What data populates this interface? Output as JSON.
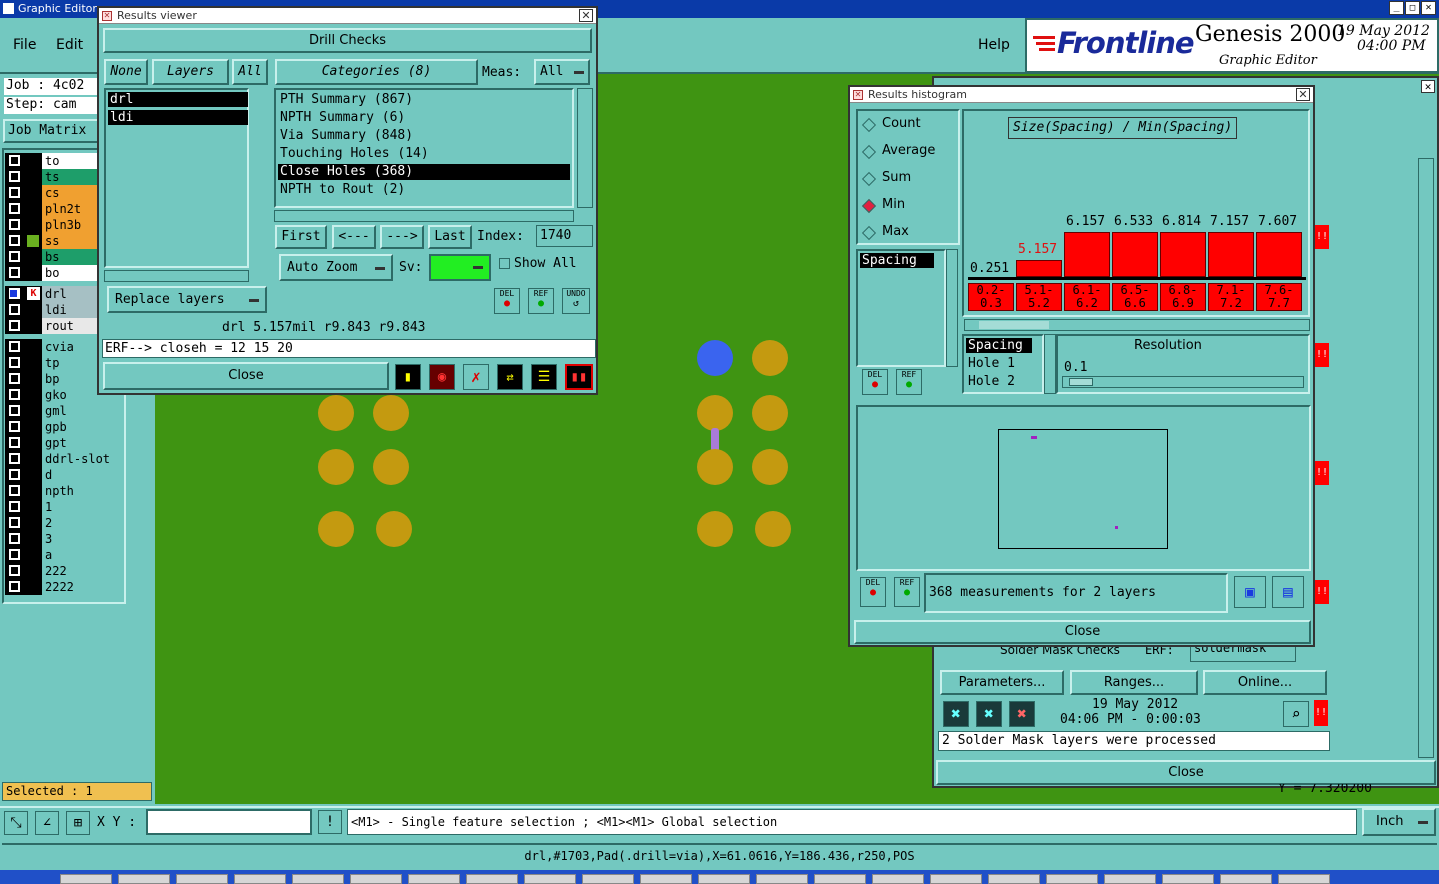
{
  "main": {
    "title": "Graphic Editor",
    "menu": [
      "File",
      "Edit"
    ],
    "help": "Help",
    "job_label": "Job : 4c02",
    "step_label": "Step: cam",
    "job_matrix": "Job Matrix",
    "brand": "Frontline",
    "product": "Genesis 2000",
    "product_sub": "Graphic Editor",
    "date": "19 May 2012",
    "time": "04:00 PM",
    "layers_a": [
      {
        "name": "to",
        "color": "#ffffff"
      },
      {
        "name": "ts",
        "color": "#1e9e6a"
      },
      {
        "name": "cs",
        "color": "#f0a030"
      },
      {
        "name": "pln2t",
        "color": "#f0a030"
      },
      {
        "name": "pln3b",
        "color": "#f0a030"
      },
      {
        "name": "ss",
        "color": "#f0a030"
      },
      {
        "name": "bs",
        "color": "#1e9e6a"
      },
      {
        "name": "bo",
        "color": "#ffffff"
      }
    ],
    "layers_b": [
      {
        "name": "drl",
        "color": "#a6c0c4"
      },
      {
        "name": "ldi",
        "color": "#a6c0c4"
      },
      {
        "name": "rout",
        "color": "#e8e8e8"
      }
    ],
    "layers_c": [
      "cvia",
      "tp",
      "bp",
      "gko",
      "gml",
      "gpb",
      "gpt",
      "ddrl-slot",
      "d",
      "npth",
      "1",
      "2",
      "3",
      "a",
      "222",
      "2222"
    ],
    "selected": "Selected : 1",
    "xy_label": "X Y :",
    "hint": "<M1> - Single feature selection ; <M1><M1> Global selection",
    "units": "Inch",
    "status": "drl,#1703,Pad(.drill=via),X=61.0616,Y=186.436,r250,POS",
    "y_readout": "Y = 7.320200"
  },
  "results_viewer": {
    "title": "Results viewer",
    "heading": "Drill Checks",
    "none_btn": "None",
    "layers_btn": "Layers",
    "all_btn": "All",
    "categories_btn": "Categories (8)",
    "meas_label": "Meas:",
    "meas_value": "All",
    "layers": [
      "drl",
      "ldi"
    ],
    "categories": [
      "PTH Summary (867)",
      "NPTH Summary (6)",
      "Via Summary (848)",
      "Touching Holes (14)",
      "Close Holes (368)",
      "NPTH to Rout (2)"
    ],
    "nav": [
      "First",
      "<---",
      "--->",
      "Last"
    ],
    "index_label": "Index:",
    "index_value": "1740",
    "auto_zoom": "Auto Zoom",
    "sv_label": "Sv:",
    "show_all": "Show All",
    "replace_layers": "Replace layers",
    "del": "DEL",
    "ref": "REF",
    "undo": "UNDO",
    "measure_line": "drl 5.157mil  r9.843  r9.843",
    "erf_line": "ERF--> closeh = 12 15 20",
    "close": "Close"
  },
  "histogram": {
    "title": "Results histogram",
    "modes": [
      "Count",
      "Average",
      "Sum",
      "Min",
      "Max"
    ],
    "selected_mode": "Min",
    "chart_title": "Size(Spacing) / Min(Spacing)",
    "spacing_label": "Spacing",
    "first_value": "0.251",
    "bars": [
      {
        "value": "5.157",
        "range": "5.1-5.2",
        "level": 0.3
      },
      {
        "value": "6.157",
        "range": "6.1-6.2",
        "level": 0.8
      },
      {
        "value": "6.533",
        "range": "6.5-6.6",
        "level": 0.8
      },
      {
        "value": "6.814",
        "range": "6.8-6.9",
        "level": 0.8
      },
      {
        "value": "7.157",
        "range": "7.1-7.2",
        "level": 0.8
      },
      {
        "value": "7.607",
        "range": "7.6-7.7",
        "level": 0.8
      }
    ],
    "first_range": "0.2-0.3",
    "list": [
      "Spacing",
      "Hole 1",
      "Hole 2"
    ],
    "resolution_label": "Resolution",
    "resolution_value": "0.1",
    "measurements": "368 measurements for 2 layers",
    "close": "Close"
  },
  "right_panel": {
    "solder_mask_checks": "Solder Mask Checks",
    "erf": "ERF:",
    "soldermask": "soldermask",
    "parameters": "Parameters...",
    "ranges": "Ranges...",
    "online": "Online...",
    "run_date": "19 May 2012",
    "run_time": "04:06 PM - 0:00:03",
    "message": "2 Solder Mask layers were processed",
    "close": "Close",
    "alert": "!!"
  }
}
